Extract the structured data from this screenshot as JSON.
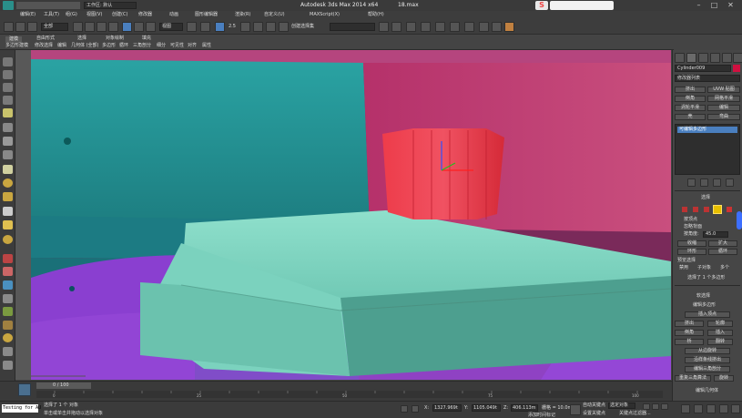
{
  "title": {
    "app": "Autodesk 3ds Max  2014 x64",
    "file": "18.max",
    "workspace": "工作区: 默认",
    "brand_badge": "S"
  },
  "menu": [
    "编辑(E)",
    "工具(T)",
    "组(G)",
    "视图(V)",
    "创建(C)",
    "修改器",
    "动画",
    "图形编辑器",
    "渲染(R)",
    "自定义(U)",
    "MAXScript(X)",
    "帮助(H)"
  ],
  "toolbar": {
    "selection_filter": "全部",
    "coord_system": "视图",
    "snap_value": "2.5",
    "named_selection": "创建选择集"
  },
  "ribbon": {
    "tabs": [
      "建模",
      "自由形式",
      "选择",
      "对象绘制",
      "填充"
    ],
    "subtabs": [
      "多边形建模",
      "修改选择",
      "编辑",
      "几何体 (全部)",
      "多边形",
      "循环",
      "三角剖分",
      "细分",
      "可见性",
      "对齐",
      "属性"
    ]
  },
  "command_panel": {
    "object_name": "Cylinder009",
    "modifier_list": "修改器列表",
    "quick_buttons": [
      "挤出",
      "UVW 贴图",
      "倒角",
      "网格平滑",
      "涡轮平滑",
      "编辑",
      "壳",
      "弯曲"
    ],
    "stack_item": "可编辑多边形",
    "selection": {
      "header": "选择",
      "by_vertex": "按顶点",
      "ignore_backfacing": "忽略背面",
      "by_angle": "按角度:",
      "angle_value": "45.0",
      "shrink": "收缩",
      "grow": "扩大",
      "ring": "环形",
      "loop": "循环",
      "preview_label": "预览选择",
      "preview_off": "禁用",
      "preview_sub": "子对象",
      "preview_multi": "多个",
      "status": "选择了 1 个多边形"
    },
    "soft_selection": "软选择",
    "edit_polygons": {
      "header": "编辑多边形",
      "insert_vertex": "插入顶点",
      "extrude": "挤出",
      "outline": "轮廓",
      "bevel": "倒角",
      "inset": "插入",
      "bridge": "桥",
      "flip": "翻转",
      "hinge": "从边旋转",
      "extrude_spline": "沿样条线挤出",
      "edit_tri": "编辑三角剖分",
      "retriangulate": "重复三角算法",
      "turn": "旋转"
    },
    "edit_geometry": "编辑几何体"
  },
  "timeline": {
    "frame_display": "0 / 100",
    "ticks": [
      "0",
      "5",
      "10",
      "15",
      "20",
      "25",
      "30",
      "35",
      "40",
      "45",
      "50",
      "55",
      "60",
      "65",
      "70",
      "75",
      "80",
      "85",
      "90",
      "95",
      "100"
    ]
  },
  "status": {
    "script_text": "Testing for AU",
    "selected": "选择了 1 个 对象",
    "prompt": "单击或单击并拖动以选择对象",
    "x_label": "X:",
    "x_value": "1327.969t",
    "y_label": "Y:",
    "y_value": "1105.049t",
    "z_label": "Z:",
    "z_value": "406.113m",
    "grid": "栅格 = 10.0mm",
    "add_time_tag": "添加时间标记",
    "auto_key": "自动关键点",
    "selected_obj": "选定对象",
    "set_key": "设置关键点",
    "key_filters": "关键点过滤器..."
  }
}
